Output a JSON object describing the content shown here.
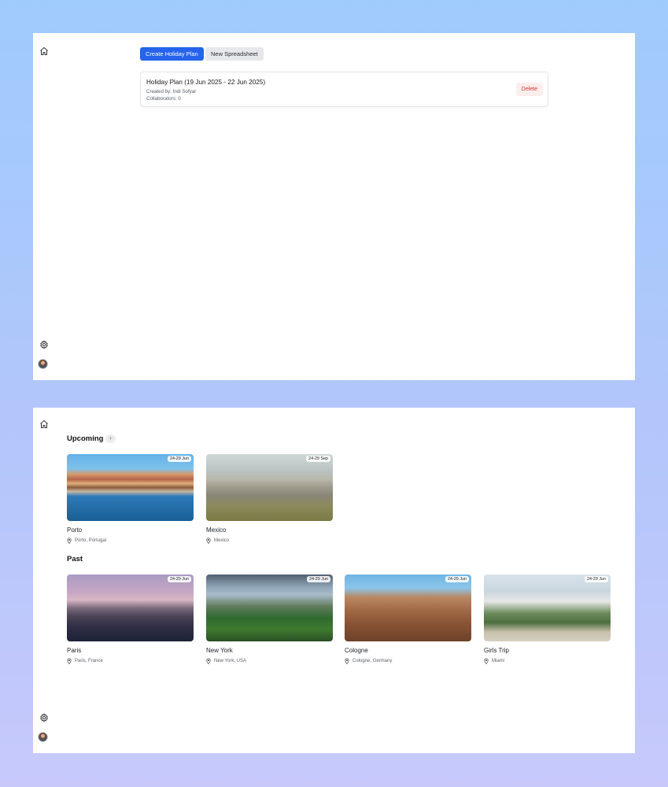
{
  "top": {
    "actions": {
      "create_label": "Create Holiday Plan",
      "spreadsheet_label": "New Spreadsheet"
    },
    "plan": {
      "title": "Holiday Plan (19 Jun 2025 - 22 Jun 2025)",
      "created_by": "Created by: Indi Sofyar",
      "collaborators": "Collaborators: 0",
      "delete_label": "Delete"
    }
  },
  "bottom": {
    "upcoming": {
      "title": "Upcoming",
      "add_label": "+",
      "trips": [
        {
          "name": "Porto",
          "location": "Porto, Portugal",
          "dates": "24-29 Jun"
        },
        {
          "name": "Mexico",
          "location": "Mexico",
          "dates": "24-29 Sep"
        }
      ]
    },
    "past": {
      "title": "Past",
      "trips": [
        {
          "name": "Paris",
          "location": "Paris, France",
          "dates": "24-29 Jun"
        },
        {
          "name": "New York",
          "location": "New York, USA",
          "dates": "24-29 Jun"
        },
        {
          "name": "Cologne",
          "location": "Cologne, Germany",
          "dates": "24-29 Jun"
        },
        {
          "name": "Girls Trip",
          "location": "Miami",
          "dates": "24-29 Jun"
        }
      ]
    }
  },
  "colors": {
    "primary": "#2563eb",
    "danger": "#d0342c",
    "background_top": "#9fcbfb",
    "background_bottom": "#c7c9fb"
  },
  "icons": [
    "home-icon",
    "gear-icon",
    "map-pin-icon",
    "avatar"
  ]
}
